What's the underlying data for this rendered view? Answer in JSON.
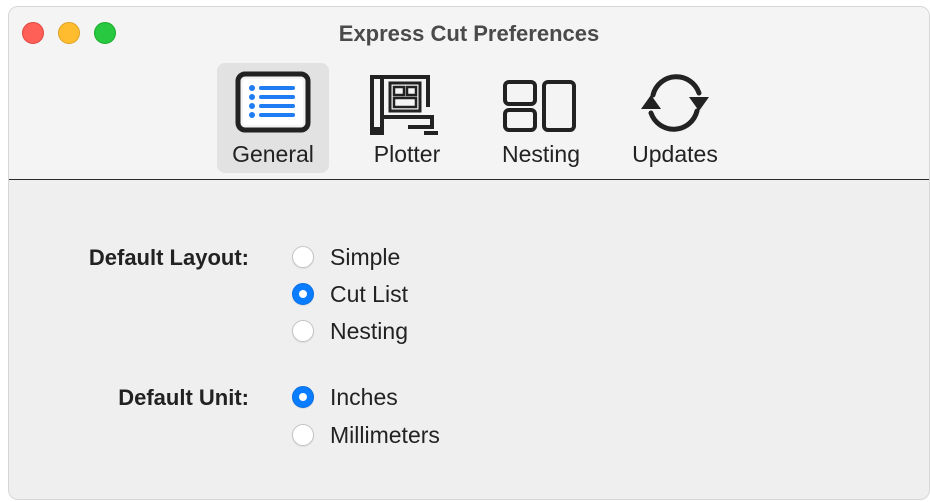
{
  "window": {
    "title": "Express Cut Preferences"
  },
  "toolbar": {
    "items": [
      {
        "label": "General",
        "icon": "list-icon",
        "selected": true
      },
      {
        "label": "Plotter",
        "icon": "plotter-icon",
        "selected": false
      },
      {
        "label": "Nesting",
        "icon": "nesting-icon",
        "selected": false
      },
      {
        "label": "Updates",
        "icon": "refresh-icon",
        "selected": false
      }
    ]
  },
  "general": {
    "layout_label": "Default Layout:",
    "layout_options": [
      {
        "label": "Simple",
        "selected": false
      },
      {
        "label": "Cut List",
        "selected": true
      },
      {
        "label": "Nesting",
        "selected": false
      }
    ],
    "unit_label": "Default Unit:",
    "unit_options": [
      {
        "label": "Inches",
        "selected": true
      },
      {
        "label": "Millimeters",
        "selected": false
      }
    ]
  },
  "colors": {
    "accent": "#0a7cff",
    "icon_blue": "#1f7cf2"
  }
}
